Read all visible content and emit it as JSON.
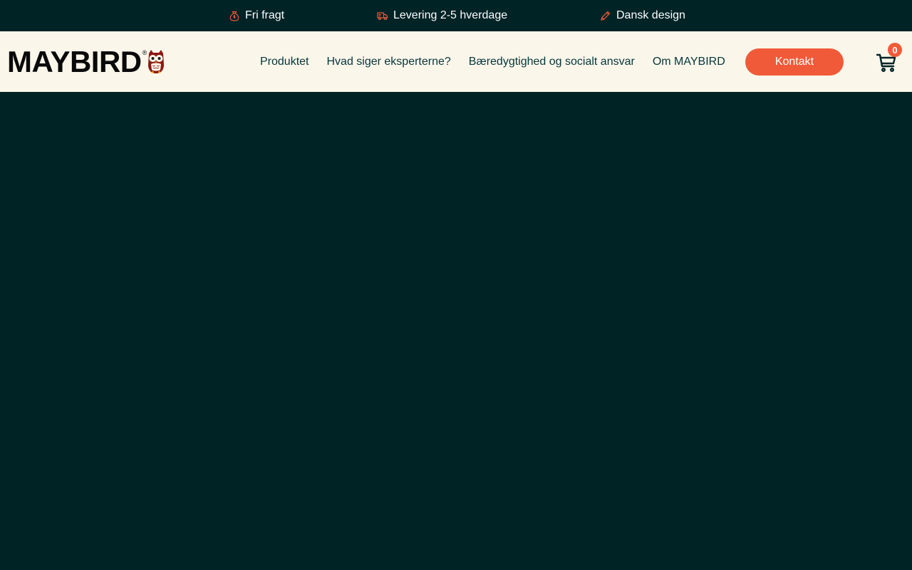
{
  "usp_bar": {
    "items": [
      {
        "label": "Fri fragt",
        "icon": "money-bag-icon"
      },
      {
        "label": "Levering 2-5 hverdage",
        "icon": "truck-icon"
      },
      {
        "label": "Dansk design",
        "icon": "pencil-icon"
      }
    ]
  },
  "header": {
    "logo": {
      "text": "MAYBIRD",
      "registered": "®"
    },
    "nav": [
      {
        "label": "Produktet"
      },
      {
        "label": "Hvad siger eksperterne?"
      },
      {
        "label": "Bæredygtighed og socialt ansvar"
      },
      {
        "label": "Om MAYBIRD"
      }
    ],
    "contact_label": "Kontakt",
    "cart_count": "0"
  },
  "colors": {
    "dark_teal": "#002326",
    "cream": "#FAF6EA",
    "accent_orange": "#F15A38",
    "nav_text": "#06363A"
  }
}
